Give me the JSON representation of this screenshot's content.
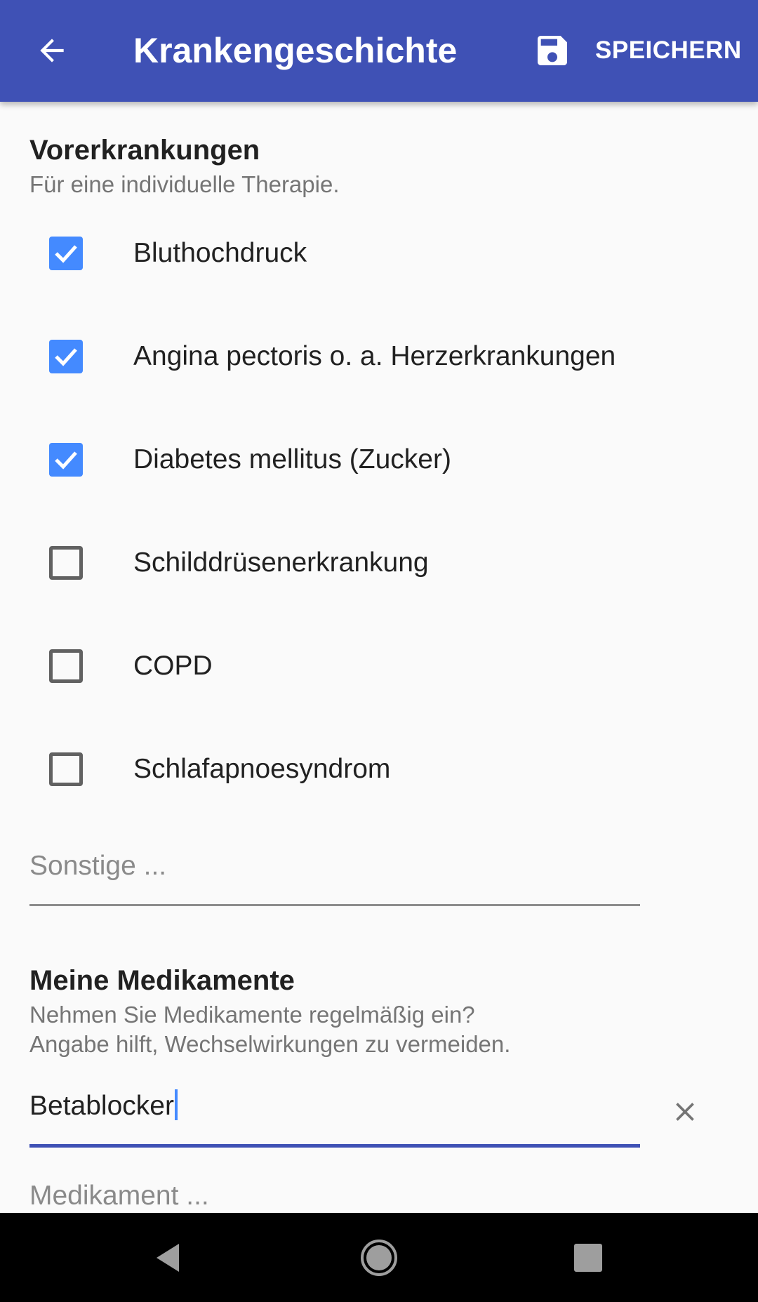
{
  "appbar": {
    "title": "Krankengeschichte",
    "save_label": "SPEICHERN",
    "background_color": "#3f51b5",
    "icons": {
      "back": "arrow-back-icon",
      "save": "floppy-disk-icon"
    }
  },
  "pre_conditions": {
    "title": "Vorerkrankungen",
    "subtitle": "Für eine individuelle Therapie.",
    "items": [
      {
        "label": "Bluthochdruck",
        "checked": true
      },
      {
        "label": "Angina pectoris o. a. Herzerkrankungen",
        "checked": true
      },
      {
        "label": "Diabetes mellitus (Zucker)",
        "checked": true
      },
      {
        "label": "Schilddrüsenerkrankung",
        "checked": false
      },
      {
        "label": "COPD",
        "checked": false
      },
      {
        "label": "Schlafapnoesyndrom",
        "checked": false
      }
    ],
    "other": {
      "placeholder": "Sonstige ...",
      "value": ""
    }
  },
  "medications": {
    "title": "Meine Medikamente",
    "subtitle_line1": "Nehmen Sie Medikamente regelmäßig ein?",
    "subtitle_line2": "Angabe hilft, Wechselwirkungen zu vermeiden.",
    "entries": [
      {
        "value": "Betablocker",
        "focused": true
      }
    ],
    "new_entry": {
      "placeholder": "Medikament ...",
      "value": ""
    }
  },
  "navbar": {
    "icons": [
      "back-triangle-icon",
      "home-circle-icon",
      "recents-square-icon"
    ]
  },
  "colors": {
    "accent": "#448aff",
    "primary": "#3f51b5",
    "text": "#212121",
    "secondary_text": "#757575"
  }
}
